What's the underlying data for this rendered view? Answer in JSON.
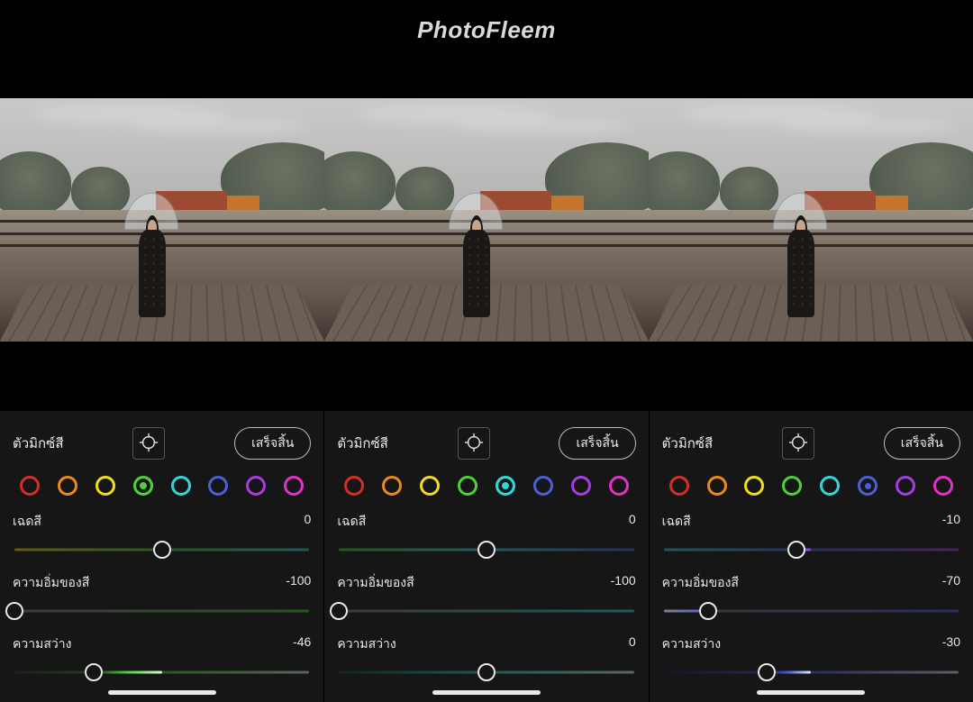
{
  "app_title": "PhotoFleem",
  "swatch_colors": [
    {
      "name": "red",
      "hex": "#d42f24"
    },
    {
      "name": "orange",
      "hex": "#e88b1c"
    },
    {
      "name": "yellow",
      "hex": "#f2dc22"
    },
    {
      "name": "green",
      "hex": "#4fcf3a"
    },
    {
      "name": "aqua",
      "hex": "#32d6d6"
    },
    {
      "name": "blue",
      "hex": "#4a5fd6"
    },
    {
      "name": "purple",
      "hex": "#a63de0"
    },
    {
      "name": "magenta",
      "hex": "#e032c3"
    }
  ],
  "panels": [
    {
      "title": "ตัวมิกซ์สี",
      "done_label": "เสร็จสิ้น",
      "selected_color_index": 3,
      "selected_style": "solid",
      "sliders": {
        "hue": {
          "label": "เฉดสี",
          "value": 0,
          "min": -100,
          "max": 100,
          "gradient": [
            "#f2dc22",
            "#4fcf3a",
            "#32d6d6"
          ]
        },
        "saturation": {
          "label": "ความอิ่มของสี",
          "value": -100,
          "min": -100,
          "max": 100,
          "gradient": [
            "#808080",
            "#4fcf3a"
          ]
        },
        "luminance": {
          "label": "ความสว่าง",
          "value": -46,
          "min": -100,
          "max": 100,
          "gradient": [
            "#183c18",
            "#4fcf3a",
            "#d6f7d6"
          ]
        }
      }
    },
    {
      "title": "ตัวมิกซ์สี",
      "done_label": "เสร็จสิ้น",
      "selected_color_index": 4,
      "selected_style": "solid",
      "sliders": {
        "hue": {
          "label": "เฉดสี",
          "value": 0,
          "min": -100,
          "max": 100,
          "gradient": [
            "#4fcf3a",
            "#32d6d6",
            "#4a5fd6"
          ]
        },
        "saturation": {
          "label": "ความอิ่มของสี",
          "value": -100,
          "min": -100,
          "max": 100,
          "gradient": [
            "#808080",
            "#32d6d6"
          ]
        },
        "luminance": {
          "label": "ความสว่าง",
          "value": 0,
          "min": -100,
          "max": 100,
          "gradient": [
            "#0e3d3d",
            "#32d6d6",
            "#d6fafa"
          ]
        }
      }
    },
    {
      "title": "ตัวมิกซ์สี",
      "done_label": "เสร็จสิ้น",
      "selected_color_index": 5,
      "selected_style": "dot",
      "sliders": {
        "hue": {
          "label": "เฉดสี",
          "value": -10,
          "min": -100,
          "max": 100,
          "gradient": [
            "#32d6d6",
            "#4a5fd6",
            "#a63de0"
          ]
        },
        "saturation": {
          "label": "ความอิ่มของสี",
          "value": -70,
          "min": -100,
          "max": 100,
          "gradient": [
            "#808080",
            "#4a5fd6"
          ]
        },
        "luminance": {
          "label": "ความสว่าง",
          "value": -30,
          "min": -100,
          "max": 100,
          "gradient": [
            "#111a4a",
            "#4a5fd6",
            "#dde3ff"
          ]
        }
      }
    }
  ]
}
